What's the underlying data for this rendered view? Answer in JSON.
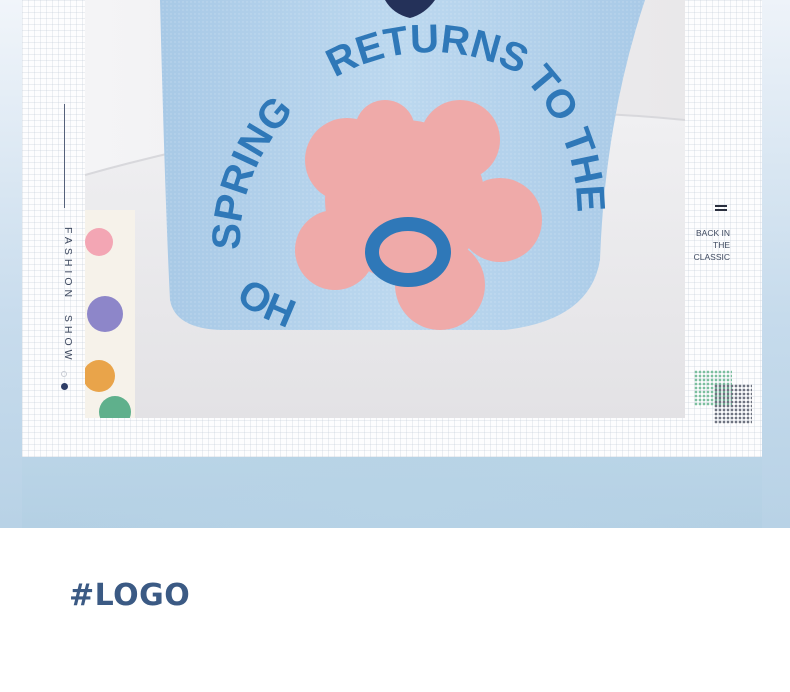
{
  "side_label": "FASHION  SHOW",
  "bag_text": {
    "arc_left": "SPRING",
    "arc_top": "RETURNS",
    "arc_right": "TO THE",
    "arc_bottom": "OHO"
  },
  "tagline": [
    "BACK IN",
    "THE",
    "CLASSIC"
  ],
  "heading": "#LOGO",
  "colors": {
    "bag_blue": "#b7d5ee",
    "letter_blue": "#2f78b8",
    "flower_pink": "#efaaa9",
    "heading_blue": "#3b5a84"
  }
}
